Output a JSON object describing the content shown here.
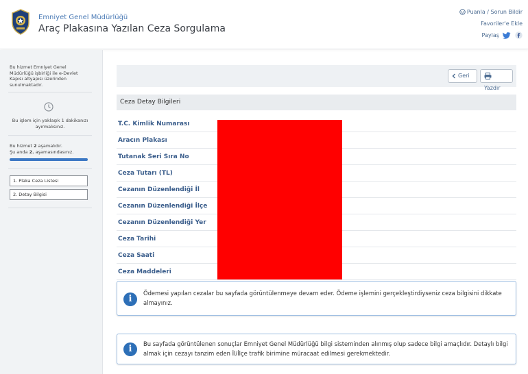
{
  "header": {
    "org_name": "Emniyet Genel Müdürlüğü",
    "title": "Araç Plakasına Yazılan Ceza Sorgulama",
    "rate_link": "Puanla / Sorun Bildir",
    "favorites_link": "Favoriler'e Ekle",
    "share_label": "Paylaş"
  },
  "sidebar": {
    "intro": "Bu hizmet Emniyet Genel Müdürlüğü işbirliği ile e-Devlet Kapısı altyapısı üzerinden sunulmaktadır.",
    "time_note": "Bu işlem için yaklaşık 1 dakikanızı ayırmalısınız.",
    "steps_line1_pre": "Bu hizmet ",
    "steps_line1_num": "2",
    "steps_line1_post": " aşamalıdır.",
    "steps_line2_pre": "Şu anda ",
    "steps_line2_num": "2.",
    "steps_line2_post": " aşamasındasınız.",
    "progress": 1.0,
    "step_items": [
      "1. Plaka Ceza Listesi",
      "2. Detay Bilgisi"
    ]
  },
  "toolbar": {
    "back_label": "Geri",
    "print_label": "Yazdır"
  },
  "detail": {
    "section_title": "Ceza Detay Bilgileri",
    "fields": [
      "T.C. Kimlik Numarası",
      "Aracın Plakası",
      "Tutanak Seri Sıra No",
      "Ceza Tutarı (TL)",
      "Cezanın Düzenlendiği İl",
      "Cezanın Düzenlendiği İlçe",
      "Cezanın Düzenlendiği Yer",
      "Ceza Tarihi",
      "Ceza Saati",
      "Ceza Maddeleri"
    ]
  },
  "notices": {
    "payment": "Ödemesi yapılan cezalar bu sayfada görüntülenmeye devam eder. Ödeme işlemini gerçekleştirdiyseniz ceza bilgisini dikkate almayınız.",
    "disclaimer": "Bu sayfada görüntülenen sonuçlar Emniyet Genel Müdürlüğü bilgi sisteminden alınmış olup sadece bilgi amaçlıdır. Detaylı bilgi almak için cezayı tanzim eden İl/İlçe trafik birimine müracaat edilmesi gerekmektedir."
  },
  "colors": {
    "accent": "#2d6fb7",
    "label_blue": "#3b5e8c",
    "redaction": "#ff0000"
  }
}
